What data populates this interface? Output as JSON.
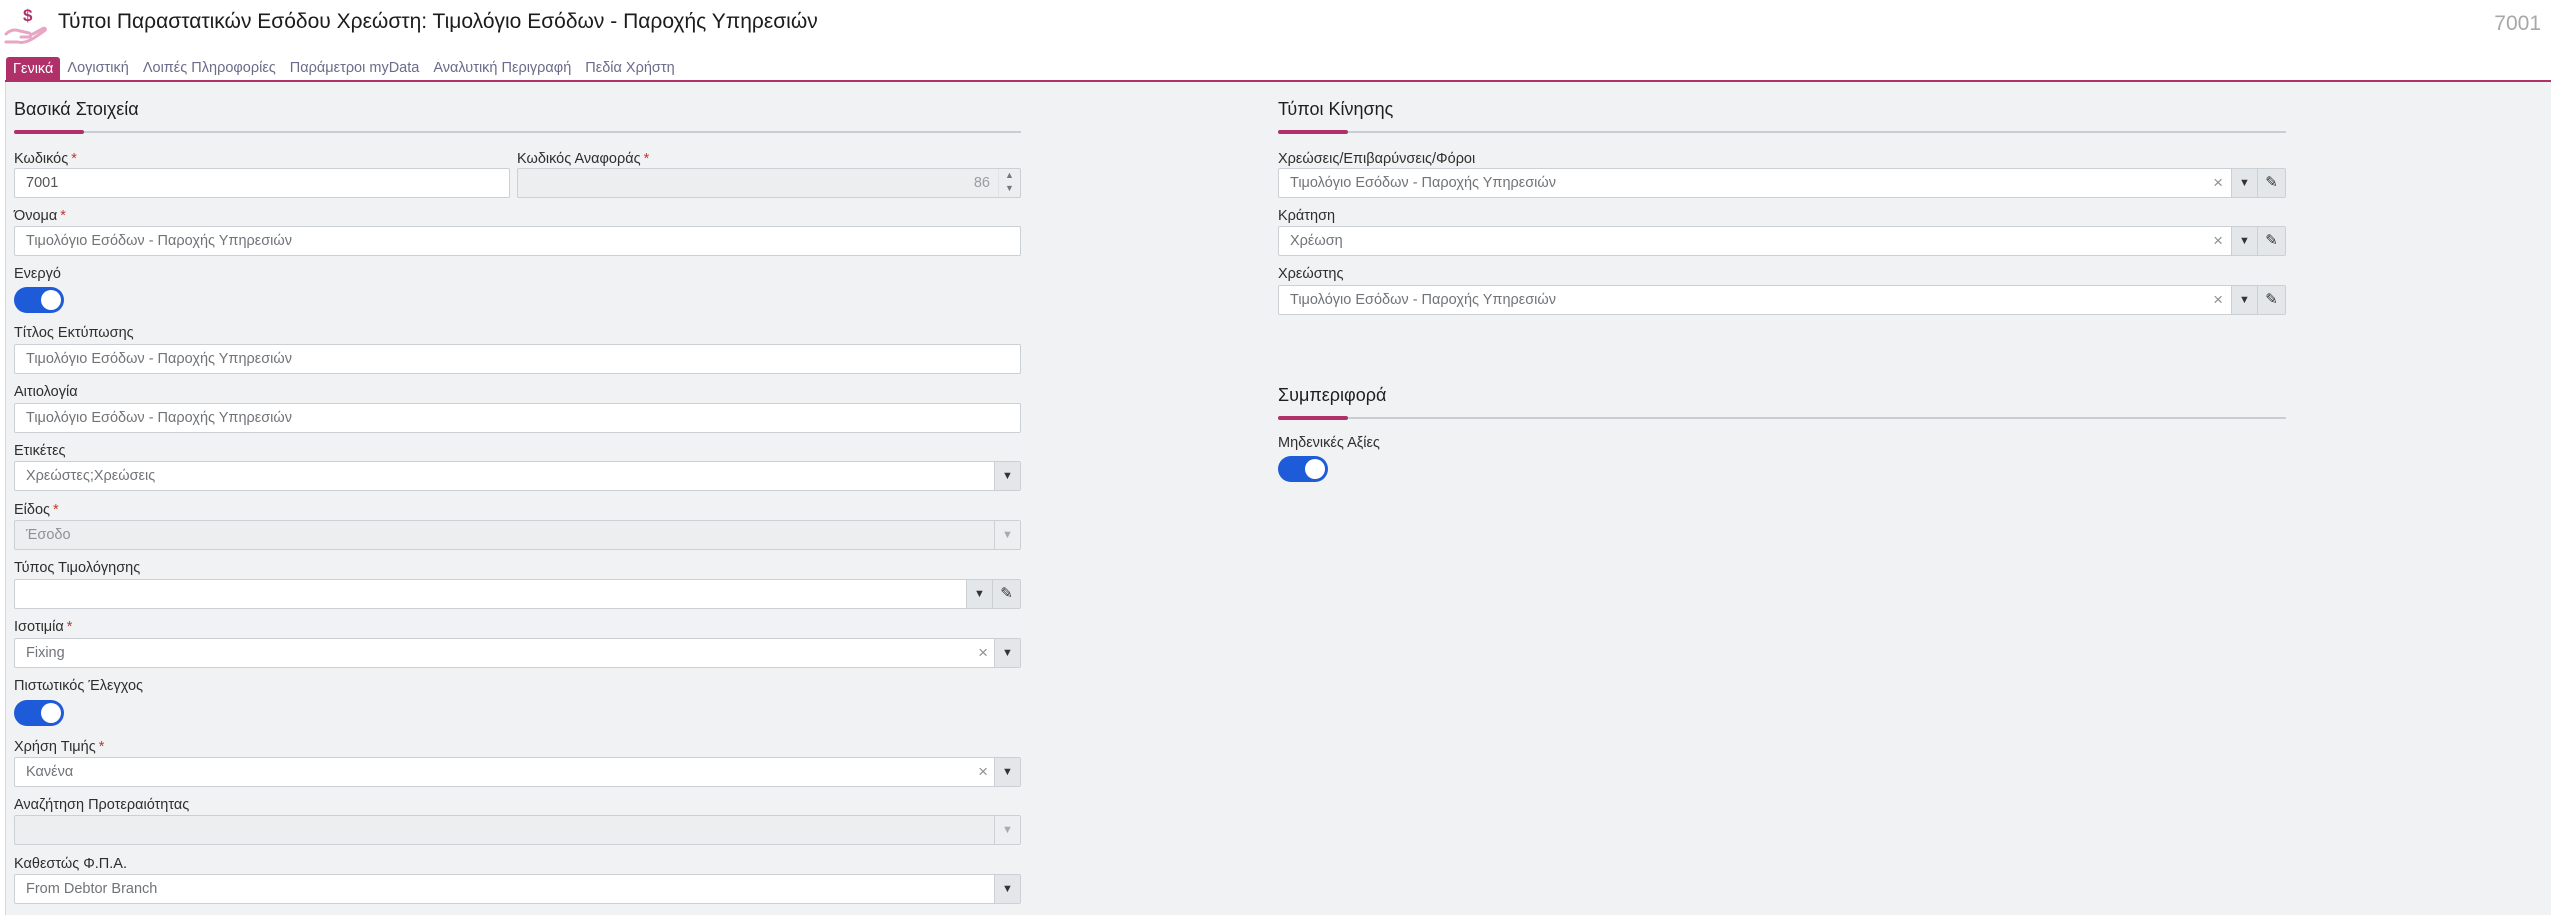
{
  "header": {
    "title": "Τύποι Παραστατικών Εσόδου Χρεώστη: Τιμολόγιο Εσόδων - Παροχής Υπηρεσιών",
    "record_id": "7001",
    "logo_icon": "hand-dollar-icon",
    "accent_color": "#b0306a"
  },
  "tabs": [
    {
      "label": "Γενικά",
      "active": true
    },
    {
      "label": "Λογιστική",
      "active": false
    },
    {
      "label": "Λοιπές Πληροφορίες",
      "active": false
    },
    {
      "label": "Παράμετροι myData",
      "active": false
    },
    {
      "label": "Αναλυτική Περιγραφή",
      "active": false
    },
    {
      "label": "Πεδία Χρήστη",
      "active": false
    }
  ],
  "basic": {
    "section_title": "Βασικά Στοιχεία",
    "code": {
      "label": "Κωδικός",
      "value": "7001"
    },
    "ref_code": {
      "label": "Κωδικός Αναφοράς",
      "value": "86"
    },
    "name": {
      "label": "Όνομα",
      "value": "Τιμολόγιο Εσόδων - Παροχής Υπηρεσιών"
    },
    "active": {
      "label": "Ενεργό",
      "on": true
    },
    "print_title": {
      "label": "Τίτλος Εκτύπωσης",
      "value": "Τιμολόγιο Εσόδων - Παροχής Υπηρεσιών"
    },
    "reason": {
      "label": "Αιτιολογία",
      "value": "Τιμολόγιο Εσόδων - Παροχής Υπηρεσιών"
    },
    "tags": {
      "label": "Ετικέτες",
      "value": "Χρεώστες;Χρεώσεις"
    },
    "kind": {
      "label": "Είδος",
      "value": "Έσοδο"
    },
    "invoice_type": {
      "label": "Τύπος Τιμολόγησης",
      "value": ""
    },
    "parity": {
      "label": "Ισοτιμία",
      "value": "Fixing"
    },
    "credit_check": {
      "label": "Πιστωτικός Έλεγχος",
      "on": true
    },
    "price_use": {
      "label": "Χρήση Τιμής",
      "value": "Κανένα"
    },
    "priority_search": {
      "label": "Αναζήτηση Προτεραιότητας",
      "value": ""
    },
    "vat_status": {
      "label": "Καθεστώς Φ.Π.Α.",
      "value": "From Debtor Branch"
    }
  },
  "movement": {
    "section_title": "Τύποι Κίνησης",
    "charges": {
      "label": "Χρεώσεις/Επιβαρύνσεις/Φόροι",
      "value": "Τιμολόγιο Εσόδων - Παροχής Υπηρεσιών"
    },
    "reservation": {
      "label": "Κράτηση",
      "value": "Χρέωση"
    },
    "debtor": {
      "label": "Χρεώστης",
      "value": "Τιμολόγιο Εσόδων - Παροχής Υπηρεσιών"
    }
  },
  "behavior": {
    "section_title": "Συμπεριφορά",
    "zero_values": {
      "label": "Μηδενικές Αξίες",
      "on": true
    }
  },
  "glyphs": {
    "required": "*",
    "clear": "×",
    "dropdown": "▼",
    "edit": "✎",
    "stepper_up": "▲",
    "stepper_down": "▼"
  }
}
